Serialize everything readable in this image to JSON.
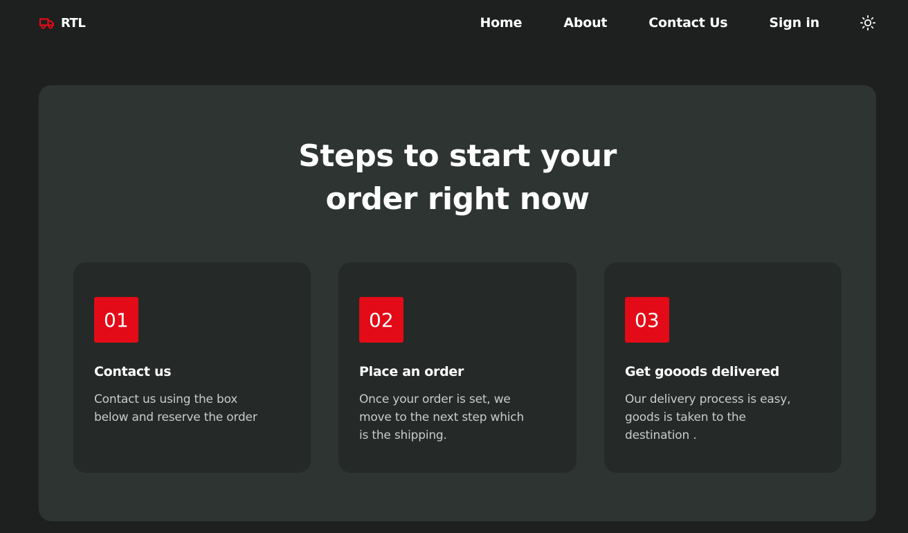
{
  "navbar": {
    "brand": {
      "label": "RTL",
      "icon": "truck-icon"
    },
    "links": [
      {
        "label": "Home"
      },
      {
        "label": "About"
      },
      {
        "label": "Contact Us"
      },
      {
        "label": "Sign in"
      }
    ],
    "theme_toggle_icon": "sun-icon"
  },
  "main": {
    "heading_line1": "Steps to start your",
    "heading_line2": "order right now",
    "steps": [
      {
        "number": "01",
        "title": "Contact us",
        "text": "Contact us using the box below and reserve the order"
      },
      {
        "number": "02",
        "title": "Place an order",
        "text": "Once your order is set, we move to the next step which is the shipping."
      },
      {
        "number": "03",
        "title": "Get gooods delivered",
        "text": "Our delivery process is easy, goods is taken to the destination ."
      }
    ]
  },
  "colors": {
    "page_background": "#1d201f",
    "panel_background": "#2e3431",
    "card_background": "#252927",
    "accent_red": "#e30b17",
    "text_primary": "#ffffff",
    "text_secondary": "#c9cdca"
  }
}
